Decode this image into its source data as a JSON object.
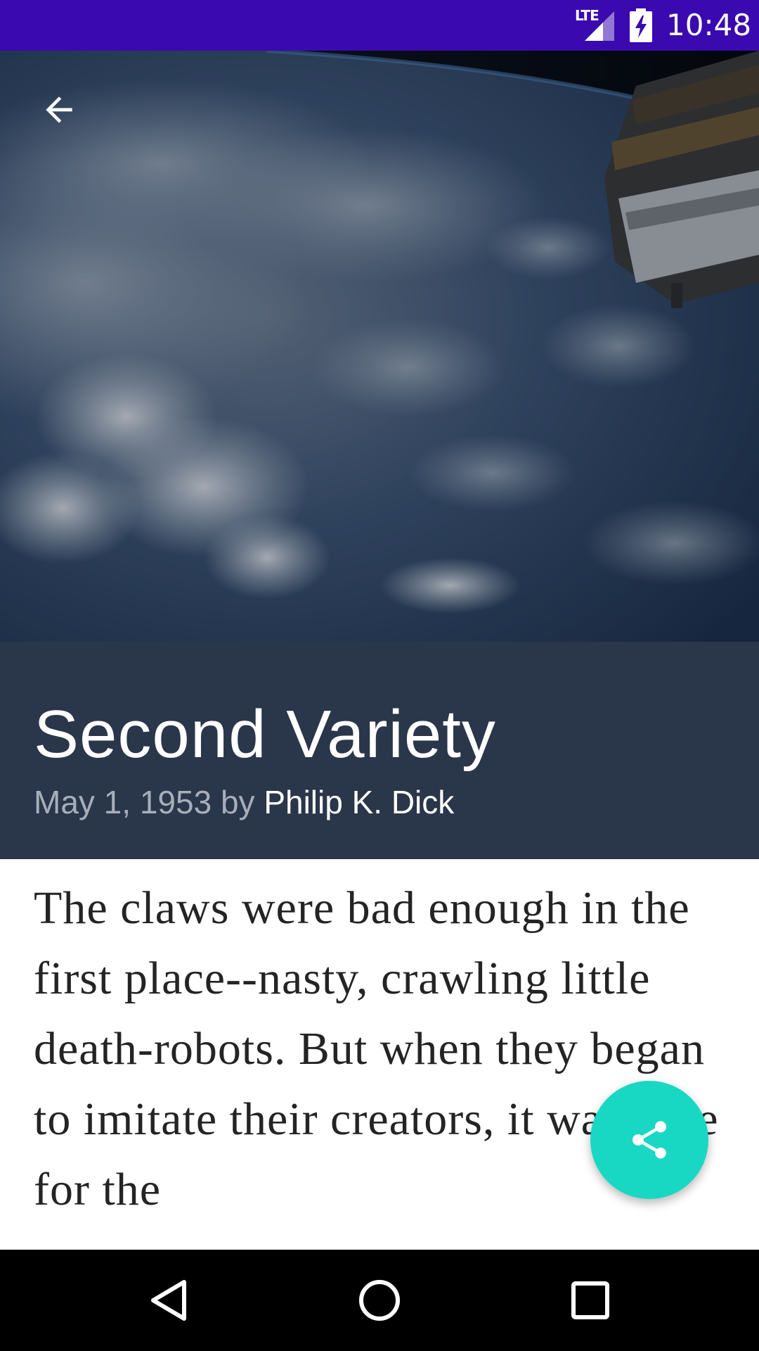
{
  "status_bar": {
    "network_label": "LTE",
    "time": "10:48",
    "icons": [
      "lte-signal-icon",
      "battery-charging-icon"
    ],
    "background_color": "#3a0ab0"
  },
  "toolbar": {
    "back_icon": "arrow-back-icon"
  },
  "hero": {
    "image_description": "earth-from-space-photo"
  },
  "article": {
    "title": "Second Variety",
    "date": "May 1, 1953",
    "by_label": "by",
    "author": "Philip K. Dick",
    "body": "The claws were bad enough in the first place--nasty, crawling little death-robots. But when they began to imitate their creators, it was time for the"
  },
  "fab": {
    "icon": "share-icon",
    "color": "#18d8c4"
  },
  "nav_bar": {
    "back_icon": "nav-back-icon",
    "home_icon": "nav-home-icon",
    "recents_icon": "nav-recents-icon"
  },
  "colors": {
    "title_panel": "#2a3649",
    "accent": "#18d8c4"
  }
}
